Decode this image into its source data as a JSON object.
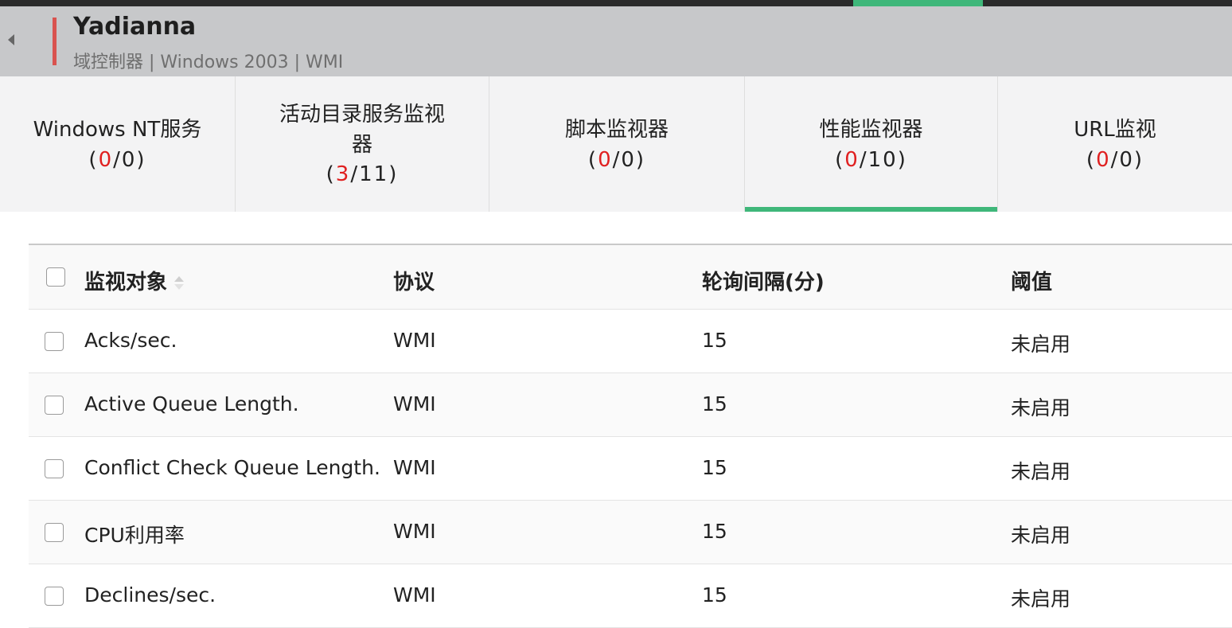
{
  "colors": {
    "accent": "#3fb77a",
    "alert_red": "#e02020",
    "status_bar_red": "#d9534f",
    "header_bg": "#c7c8ca"
  },
  "header": {
    "back_icon": "caret-left-icon",
    "title": "Yadianna",
    "subtitle": "域控制器 | Windows 2003  | WMI"
  },
  "tabs": [
    {
      "name": "Windows NT服务",
      "alert": "0",
      "total": "0",
      "active": false
    },
    {
      "name": "活动目录服务监视器",
      "alert": "3",
      "total": "11",
      "active": false
    },
    {
      "name": "脚本监视器",
      "alert": "0",
      "total": "0",
      "active": false
    },
    {
      "name": "性能监视器",
      "alert": "0",
      "total": "10",
      "active": true
    },
    {
      "name": "URL监视",
      "alert": "0",
      "total": "0",
      "active": false
    }
  ],
  "table": {
    "columns": [
      "监视对象",
      "协议",
      "轮询间隔(分)",
      "阈值"
    ],
    "sort_icon": "sort-icon",
    "rows": [
      {
        "name": "Acks/sec.",
        "protocol": "WMI",
        "interval": "15",
        "threshold": "未启用"
      },
      {
        "name": "Active Queue Length.",
        "protocol": "WMI",
        "interval": "15",
        "threshold": "未启用"
      },
      {
        "name": "Conflict Check Queue Length.",
        "protocol": "WMI",
        "interval": "15",
        "threshold": "未启用"
      },
      {
        "name": "CPU利用率",
        "protocol": "WMI",
        "interval": "15",
        "threshold": "未启用"
      },
      {
        "name": "Declines/sec.",
        "protocol": "WMI",
        "interval": "15",
        "threshold": "未启用"
      }
    ]
  }
}
